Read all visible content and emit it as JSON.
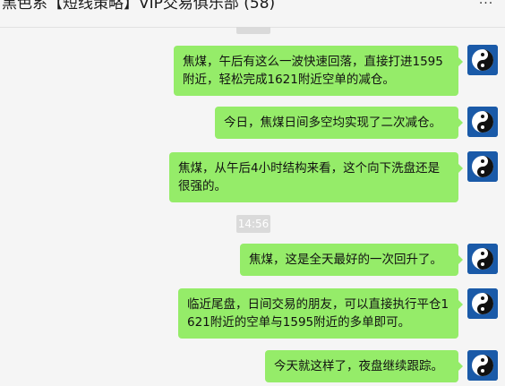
{
  "window": {
    "title": "黑色系【短线策略】VIP交易俱乐部 (58)",
    "more_icon": "more-icon"
  },
  "timestamps": {
    "middle": "14:56"
  },
  "messages": [
    {
      "text": "焦煤，午后有这么一波快速回落，直接打进1595附近，轻松完成1621附近空单的减仓。",
      "avatar_icon": "yin-yang-icon"
    },
    {
      "text": "今日，焦煤日间多空均实现了二次减仓。",
      "avatar_icon": "yin-yang-icon"
    },
    {
      "text": "焦煤，从午后4小时结构来看，这个向下洗盘还是很强的。",
      "avatar_icon": "yin-yang-icon"
    },
    {
      "text": "焦煤，这是全天最好的一次回升了。",
      "avatar_icon": "yin-yang-icon"
    },
    {
      "text": "临近尾盘，日间交易的朋友，可以直接执行平仓1621附近的空单与1595附近的多单即可。",
      "avatar_icon": "yin-yang-icon"
    },
    {
      "text": "今天就这样了，夜盘继续跟踪。",
      "avatar_icon": "yin-yang-icon"
    }
  ],
  "colors": {
    "bubble": "#95ec69",
    "background": "#f5f5f5",
    "avatar_bg": "#1a5aa8"
  }
}
